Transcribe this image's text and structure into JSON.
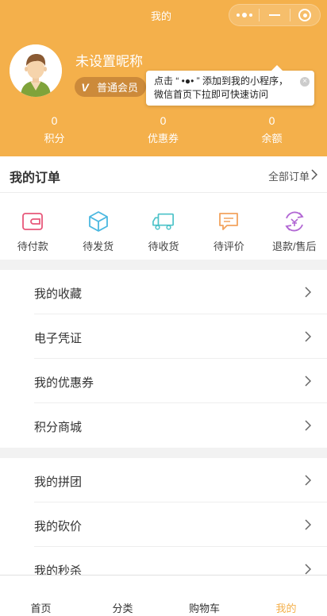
{
  "nav": {
    "title": "我的"
  },
  "profile": {
    "nickname": "未设置昵称",
    "member_badge": "普通会员",
    "badge_icon": "V"
  },
  "tooltip": {
    "text": "点击 “ •●• ” 添加到我的小程序，微信首页下拉即可快速访问"
  },
  "stats": [
    {
      "value": "0",
      "label": "积分"
    },
    {
      "value": "0",
      "label": "优惠券"
    },
    {
      "value": "0",
      "label": "余额"
    }
  ],
  "orders": {
    "title": "我的订单",
    "view_all": "全部订单",
    "items": [
      {
        "label": "待付款",
        "icon": "wallet-icon",
        "color": "#e8577a"
      },
      {
        "label": "待发货",
        "icon": "box-icon",
        "color": "#4bb8e0"
      },
      {
        "label": "待收货",
        "icon": "truck-icon",
        "color": "#4bc2c8"
      },
      {
        "label": "待评价",
        "icon": "comment-icon",
        "color": "#f2a35e"
      },
      {
        "label": "退款/售后",
        "icon": "refund-icon",
        "color": "#b268d4"
      }
    ]
  },
  "menu_group_1": [
    "我的收藏",
    "电子凭证",
    "我的优惠券",
    "积分商城"
  ],
  "menu_group_2": [
    "我的拼团",
    "我的砍价",
    "我的秒杀"
  ],
  "tabbar": [
    "首页",
    "分类",
    "购物车",
    "我的"
  ],
  "colors": {
    "accent": "#f4b04b",
    "badge": "#cc8a3a"
  }
}
